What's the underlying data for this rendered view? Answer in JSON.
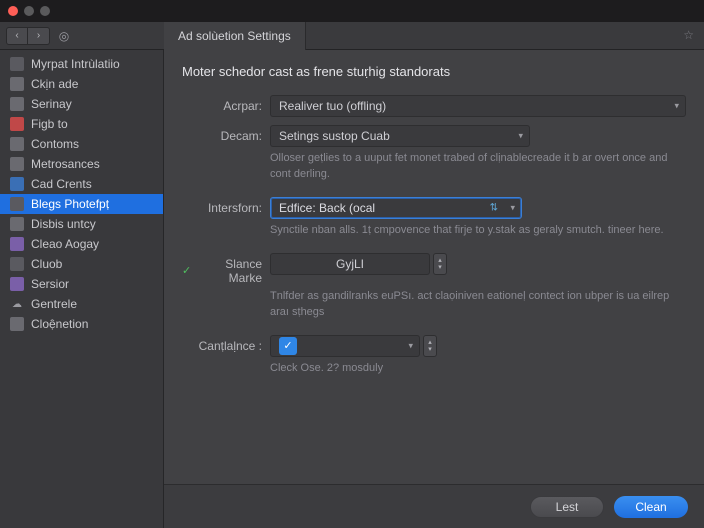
{
  "titlebar": {},
  "toolbar": {
    "tab_title": "Ad solùetion Settings"
  },
  "sidebar": {
    "items": [
      {
        "label": "Myrpat Intrùlatiio",
        "icon": "sq",
        "icon_class": "ic-sq"
      },
      {
        "label": "Ckịn ade",
        "icon": "gear",
        "icon_class": "ic-gray"
      },
      {
        "label": "Serinay",
        "icon": "doc",
        "icon_class": "ic-gray"
      },
      {
        "label": "Figb to",
        "icon": "red",
        "icon_class": "ic-red"
      },
      {
        "label": "Contoms",
        "icon": "doc",
        "icon_class": "ic-gray"
      },
      {
        "label": "Metrosances",
        "icon": "sq",
        "icon_class": "ic-gray"
      },
      {
        "label": "Cad Crents",
        "icon": "blue",
        "icon_class": "ic-blue"
      },
      {
        "label": "Blegs Photefpṭ",
        "icon": "sq",
        "icon_class": "ic-sq",
        "selected": true
      },
      {
        "label": "Disbis untcy",
        "icon": "disk",
        "icon_class": "ic-gray"
      },
      {
        "label": "Cleao Aogay",
        "icon": "purple",
        "icon_class": "ic-purple"
      },
      {
        "label": "Cluob",
        "icon": "sq",
        "icon_class": "ic-sq"
      },
      {
        "label": "Sersior",
        "icon": "purple",
        "icon_class": "ic-purple"
      },
      {
        "label": "Gentrele",
        "icon": "cloud",
        "icon_class": "ic-cloud"
      },
      {
        "label": "Cloệnetion",
        "icon": "gear",
        "icon_class": "ic-gray"
      }
    ]
  },
  "form": {
    "heading": "Moter schedor cast as frene stuṛhig standorats",
    "acrpar": {
      "label": "Acrpar:",
      "value": "Realiver tuo (offling)"
    },
    "decam": {
      "label": "Decam:",
      "value": "Setings sustop Cuab",
      "help": "Olloser geṭlies to a uuput fet monet trabed of clịnablecreade it b ar overt once and cont derling."
    },
    "intersform": {
      "label": "Intersforn:",
      "value": "Edfice: Back (ocal",
      "help": "Synctile nban alls. 1ṭ cmpovence that firje to y.stak as geraly smutch. tineer here."
    },
    "slance": {
      "label": "Slance Marke",
      "checked": true,
      "value": "GyjLI",
      "help": "Tnlfder as gandilranks euPSı. act claọiniven eationeḷ contect ion ubper is ua eilrep araı sṭhegs"
    },
    "cantiance": {
      "label": "Canṭlaḷnce :",
      "checked": true,
      "help": "Cleck Ose. 2? mosduly"
    }
  },
  "footer": {
    "lest": "Lest",
    "clean": "Clean"
  }
}
